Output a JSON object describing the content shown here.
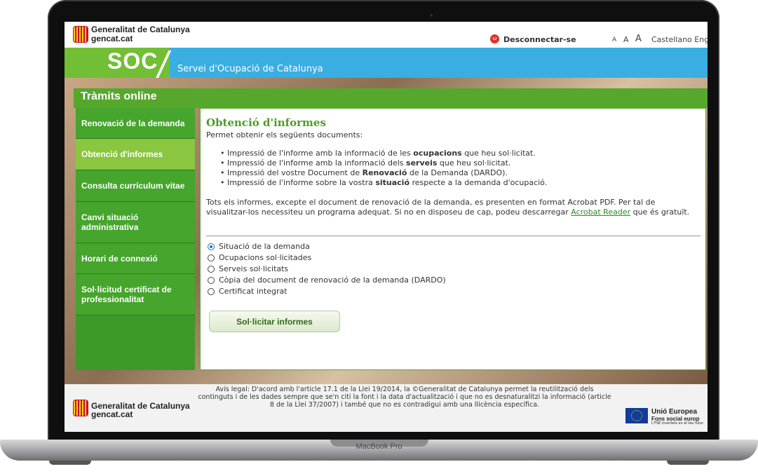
{
  "header": {
    "org_name": "Generalitat de Catalunya",
    "org_domain": "gencat.cat",
    "logout_label": "Desconnectar-se",
    "font_sizes": [
      "A",
      "A",
      "A"
    ],
    "languages": "Castellano Eng"
  },
  "banner": {
    "logo": "SOC",
    "title": "Servei d'Ocupació de Catalunya"
  },
  "panel_title": "Tràmits online",
  "sidebar": {
    "items": [
      {
        "label": "Renovació de la demanda",
        "active": false
      },
      {
        "label": "Obtenció d'informes",
        "active": true
      },
      {
        "label": "Consulta currículum vitae",
        "active": false
      },
      {
        "label": "Canvi situació administrativa",
        "active": false
      },
      {
        "label": "Horari de connexió",
        "active": false
      },
      {
        "label": "Sol·licitud certificat de professionalitat",
        "active": false
      }
    ]
  },
  "main": {
    "title": "Obtenció d'informes",
    "intro": "Permet obtenir els següents documents:",
    "bullets": [
      {
        "pre": "Impressió de l'informe amb la informació de les ",
        "bold": "ocupacions",
        "post": " que heu sol·licitat."
      },
      {
        "pre": "Impressió de l'informe amb la informació dels ",
        "bold": "serveis",
        "post": " que heu sol·licitat."
      },
      {
        "pre": "Impressió del vostre Document de ",
        "bold": "Renovació",
        "post": " de la Demanda (DARDO)."
      },
      {
        "pre": "Impressió de l'informe sobre la vostra ",
        "bold": "situació",
        "post": " respecte a la demanda d'ocupació."
      }
    ],
    "para_pre": "Tots els informes, excepte el document de renovació de la demanda, es presenten en format Acrobat PDF. Per tal de visualitzar-los necessiteu un programa adequat. Si no en disposeu de cap, podeu descarregar ",
    "para_link": "Acrobat Reader",
    "para_post": " que és gratuït.",
    "options": [
      {
        "label": "Situació de la demanda",
        "checked": true
      },
      {
        "label": "Ocupacions sol·licitades",
        "checked": false
      },
      {
        "label": "Serveis sol·licitats",
        "checked": false
      },
      {
        "label": "Còpia del document de renovació de la demanda (DARDO)",
        "checked": false
      },
      {
        "label": "Certificat integrat",
        "checked": false
      }
    ],
    "submit_label": "Sol·licitar informes"
  },
  "footer": {
    "org_name": "Generalitat de Catalunya",
    "org_domain": "gencat.cat",
    "legal": "Avís legal: D'acord amb l'article 17.1 de la Llei 19/2014, la ©Generalitat de Catalunya permet la reutilització dels continguts i de les dades sempre que se'n citi la font i la data d'actualització i que no es desnaturalitzi la informació (article 8 de la Llei 37/2007) i també que no es contradigui amb una llicència específica.",
    "eu_title": "Unió Europea",
    "eu_subtitle": "Fons social europ",
    "eu_note": "L'FSE inverteix en el teu futur"
  },
  "device_label": "MacBook Pro",
  "colors": {
    "green_dark": "#45a52c",
    "green_active": "#8ac63f",
    "blue_band": "#39aee3",
    "title_green": "#4e9a2a"
  }
}
